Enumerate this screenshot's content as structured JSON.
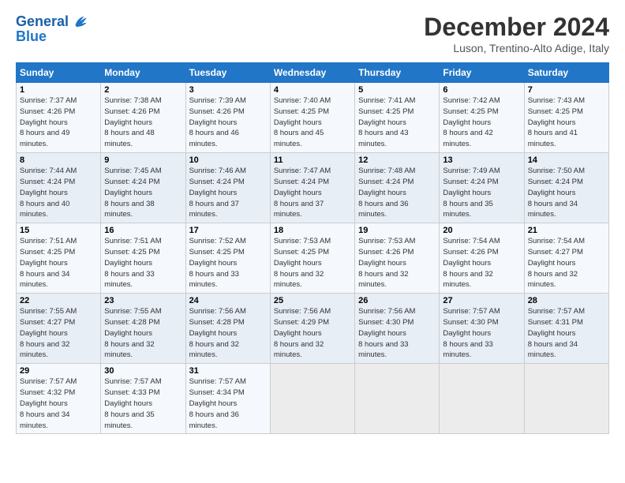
{
  "logo": {
    "line1": "General",
    "line2": "Blue"
  },
  "title": "December 2024",
  "subtitle": "Luson, Trentino-Alto Adige, Italy",
  "days_header": [
    "Sunday",
    "Monday",
    "Tuesday",
    "Wednesday",
    "Thursday",
    "Friday",
    "Saturday"
  ],
  "weeks": [
    [
      {
        "num": "1",
        "rise": "7:37 AM",
        "set": "4:26 PM",
        "daylight": "8 hours and 49 minutes."
      },
      {
        "num": "2",
        "rise": "7:38 AM",
        "set": "4:26 PM",
        "daylight": "8 hours and 48 minutes."
      },
      {
        "num": "3",
        "rise": "7:39 AM",
        "set": "4:26 PM",
        "daylight": "8 hours and 46 minutes."
      },
      {
        "num": "4",
        "rise": "7:40 AM",
        "set": "4:25 PM",
        "daylight": "8 hours and 45 minutes."
      },
      {
        "num": "5",
        "rise": "7:41 AM",
        "set": "4:25 PM",
        "daylight": "8 hours and 43 minutes."
      },
      {
        "num": "6",
        "rise": "7:42 AM",
        "set": "4:25 PM",
        "daylight": "8 hours and 42 minutes."
      },
      {
        "num": "7",
        "rise": "7:43 AM",
        "set": "4:25 PM",
        "daylight": "8 hours and 41 minutes."
      }
    ],
    [
      {
        "num": "8",
        "rise": "7:44 AM",
        "set": "4:24 PM",
        "daylight": "8 hours and 40 minutes."
      },
      {
        "num": "9",
        "rise": "7:45 AM",
        "set": "4:24 PM",
        "daylight": "8 hours and 38 minutes."
      },
      {
        "num": "10",
        "rise": "7:46 AM",
        "set": "4:24 PM",
        "daylight": "8 hours and 37 minutes."
      },
      {
        "num": "11",
        "rise": "7:47 AM",
        "set": "4:24 PM",
        "daylight": "8 hours and 37 minutes."
      },
      {
        "num": "12",
        "rise": "7:48 AM",
        "set": "4:24 PM",
        "daylight": "8 hours and 36 minutes."
      },
      {
        "num": "13",
        "rise": "7:49 AM",
        "set": "4:24 PM",
        "daylight": "8 hours and 35 minutes."
      },
      {
        "num": "14",
        "rise": "7:50 AM",
        "set": "4:24 PM",
        "daylight": "8 hours and 34 minutes."
      }
    ],
    [
      {
        "num": "15",
        "rise": "7:51 AM",
        "set": "4:25 PM",
        "daylight": "8 hours and 34 minutes."
      },
      {
        "num": "16",
        "rise": "7:51 AM",
        "set": "4:25 PM",
        "daylight": "8 hours and 33 minutes."
      },
      {
        "num": "17",
        "rise": "7:52 AM",
        "set": "4:25 PM",
        "daylight": "8 hours and 33 minutes."
      },
      {
        "num": "18",
        "rise": "7:53 AM",
        "set": "4:25 PM",
        "daylight": "8 hours and 32 minutes."
      },
      {
        "num": "19",
        "rise": "7:53 AM",
        "set": "4:26 PM",
        "daylight": "8 hours and 32 minutes."
      },
      {
        "num": "20",
        "rise": "7:54 AM",
        "set": "4:26 PM",
        "daylight": "8 hours and 32 minutes."
      },
      {
        "num": "21",
        "rise": "7:54 AM",
        "set": "4:27 PM",
        "daylight": "8 hours and 32 minutes."
      }
    ],
    [
      {
        "num": "22",
        "rise": "7:55 AM",
        "set": "4:27 PM",
        "daylight": "8 hours and 32 minutes."
      },
      {
        "num": "23",
        "rise": "7:55 AM",
        "set": "4:28 PM",
        "daylight": "8 hours and 32 minutes."
      },
      {
        "num": "24",
        "rise": "7:56 AM",
        "set": "4:28 PM",
        "daylight": "8 hours and 32 minutes."
      },
      {
        "num": "25",
        "rise": "7:56 AM",
        "set": "4:29 PM",
        "daylight": "8 hours and 32 minutes."
      },
      {
        "num": "26",
        "rise": "7:56 AM",
        "set": "4:30 PM",
        "daylight": "8 hours and 33 minutes."
      },
      {
        "num": "27",
        "rise": "7:57 AM",
        "set": "4:30 PM",
        "daylight": "8 hours and 33 minutes."
      },
      {
        "num": "28",
        "rise": "7:57 AM",
        "set": "4:31 PM",
        "daylight": "8 hours and 34 minutes."
      }
    ],
    [
      {
        "num": "29",
        "rise": "7:57 AM",
        "set": "4:32 PM",
        "daylight": "8 hours and 34 minutes."
      },
      {
        "num": "30",
        "rise": "7:57 AM",
        "set": "4:33 PM",
        "daylight": "8 hours and 35 minutes."
      },
      {
        "num": "31",
        "rise": "7:57 AM",
        "set": "4:34 PM",
        "daylight": "8 hours and 36 minutes."
      },
      null,
      null,
      null,
      null
    ]
  ],
  "colors": {
    "header_bg": "#2176c7",
    "row_odd": "#f5f8fc",
    "row_even": "#e8eef6"
  }
}
